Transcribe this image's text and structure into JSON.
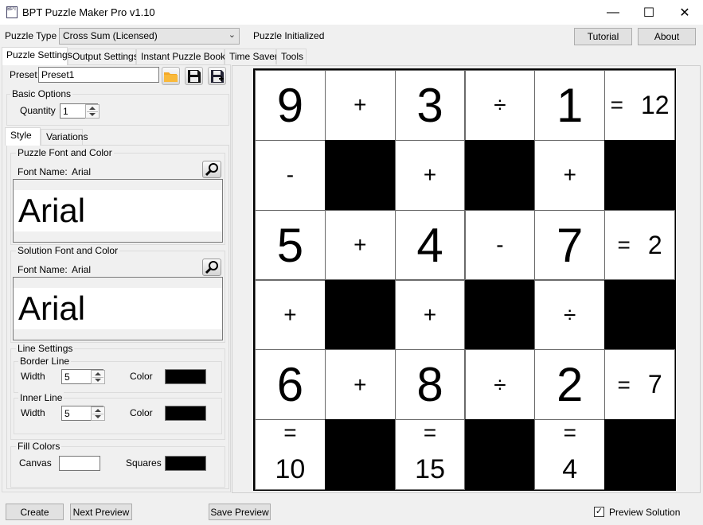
{
  "window": {
    "title": "BPT Puzzle Maker Pro v1.10",
    "minimize_glyph": "—",
    "maximize_glyph": "☐",
    "close_glyph": "✕"
  },
  "toolbar": {
    "puzzle_type_label": "Puzzle Type",
    "puzzle_type_value": "Cross Sum (Licensed)",
    "status": "Puzzle Initialized",
    "tutorial": "Tutorial",
    "about": "About"
  },
  "tabs": [
    "Puzzle Settings",
    "Output Settings",
    "Instant Puzzle Books",
    "Time Saver",
    "Tools"
  ],
  "settings": {
    "preset_label": "Preset",
    "preset_value": "Preset1",
    "basic_options_title": "Basic Options",
    "quantity_label": "Quantity",
    "quantity_value": "1",
    "subtabs": [
      "Style",
      "Variations"
    ],
    "puzzle_font_title": "Puzzle Font and Color",
    "puzzle_font_name_label": "Font Name:",
    "puzzle_font_name": "Arial",
    "puzzle_font_sample": "Arial",
    "solution_font_title": "Solution Font and Color",
    "solution_font_name_label": "Font Name:",
    "solution_font_name": "Arial",
    "solution_font_sample": "Arial",
    "line_settings_title": "Line Settings",
    "border_line_title": "Border Line",
    "border_width_label": "Width",
    "border_width_value": "5",
    "border_color_label": "Color",
    "border_color": "#000000",
    "inner_line_title": "Inner Line",
    "inner_width_label": "Width",
    "inner_width_value": "5",
    "inner_color_label": "Color",
    "inner_color": "#000000",
    "fill_colors_title": "Fill Colors",
    "canvas_label": "Canvas",
    "canvas_color": "#ffffff",
    "squares_label": "Squares",
    "squares_color": "#000000"
  },
  "puzzle": {
    "rows": [
      [
        {
          "t": "digit",
          "v": "9"
        },
        {
          "t": "op",
          "v": "+"
        },
        {
          "t": "digit",
          "v": "3"
        },
        {
          "t": "op",
          "v": "÷"
        },
        {
          "t": "digit",
          "v": "1"
        },
        {
          "t": "res",
          "eq": "=",
          "v": "12"
        }
      ],
      [
        {
          "t": "op",
          "v": "-"
        },
        {
          "t": "black"
        },
        {
          "t": "op",
          "v": "+"
        },
        {
          "t": "black"
        },
        {
          "t": "op",
          "v": "+"
        },
        {
          "t": "black"
        }
      ],
      [
        {
          "t": "digit",
          "v": "5"
        },
        {
          "t": "op",
          "v": "+"
        },
        {
          "t": "digit",
          "v": "4"
        },
        {
          "t": "op",
          "v": "-"
        },
        {
          "t": "digit",
          "v": "7"
        },
        {
          "t": "res",
          "eq": "=",
          "v": "2"
        }
      ],
      [
        {
          "t": "op",
          "v": "+"
        },
        {
          "t": "black"
        },
        {
          "t": "op",
          "v": "+"
        },
        {
          "t": "black"
        },
        {
          "t": "op",
          "v": "÷"
        },
        {
          "t": "black"
        }
      ],
      [
        {
          "t": "digit",
          "v": "6"
        },
        {
          "t": "op",
          "v": "+"
        },
        {
          "t": "digit",
          "v": "8"
        },
        {
          "t": "op",
          "v": "÷"
        },
        {
          "t": "digit",
          "v": "2"
        },
        {
          "t": "res",
          "eq": "=",
          "v": "7"
        }
      ],
      [
        {
          "t": "colres",
          "eq": "=",
          "v": "10"
        },
        {
          "t": "black"
        },
        {
          "t": "colres",
          "eq": "=",
          "v": "15"
        },
        {
          "t": "black"
        },
        {
          "t": "colres",
          "eq": "=",
          "v": "4"
        },
        {
          "t": "black"
        }
      ]
    ]
  },
  "footer": {
    "create": "Create",
    "next_preview": "Next Preview",
    "save_preview": "Save Preview",
    "preview_solution_label": "Preview Solution",
    "preview_solution_checked": true
  }
}
